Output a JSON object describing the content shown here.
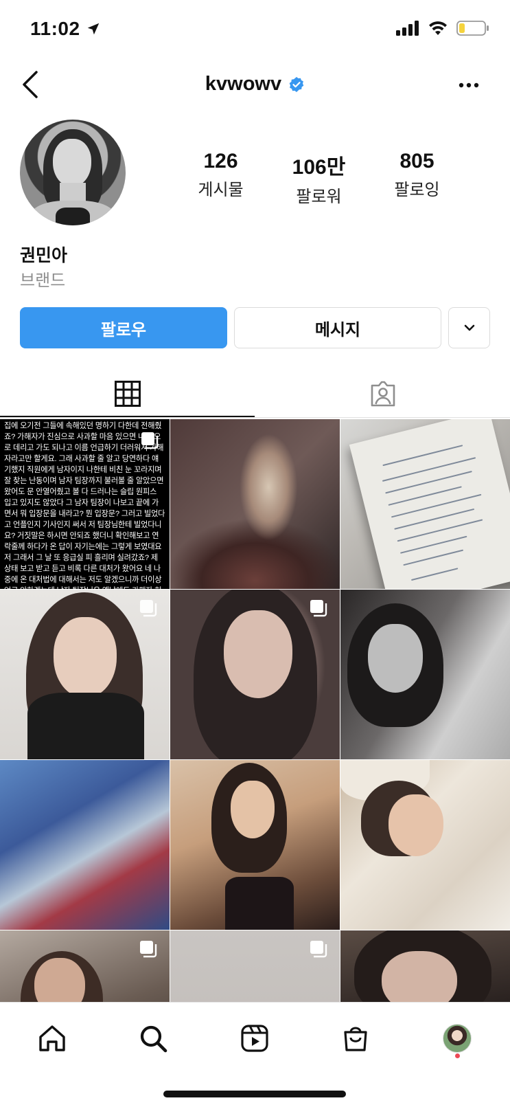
{
  "status_bar": {
    "time": "11:02",
    "icons": [
      "location-arrow-icon",
      "signal-bars-icon",
      "wifi-icon",
      "battery-low-icon"
    ]
  },
  "header": {
    "username": "kvwowv",
    "verified_icon": "verified-badge-icon",
    "back_icon": "chevron-left-icon",
    "more_icon": "more-horizontal-icon"
  },
  "profile": {
    "name": "권민아",
    "category": "브랜드",
    "stats": [
      {
        "value": "126",
        "label": "게시물"
      },
      {
        "value": "106만",
        "label": "팔로워"
      },
      {
        "value": "805",
        "label": "팔로잉"
      }
    ]
  },
  "actions": {
    "follow_label": "팔로우",
    "message_label": "메시지",
    "more_icon": "chevron-down-icon",
    "follow_color": "#3897f0"
  },
  "tabs": [
    {
      "name": "grid",
      "icon": "grid-icon",
      "active": true
    },
    {
      "name": "tagged",
      "icon": "tagged-person-icon",
      "active": false
    }
  ],
  "posts": {
    "text_post": "집에 오기전 그들에 속해있던 명하기 다한데 전해줬죠? 가해자가 진심으로 사과할 마음 있으면 내 집으로 데리고 가도 되나고 이름 언급하기 더러워서 가해자라고만 할게요. 그래 사과할 줄 알고 당연하다 얘기했지 직원에게 남자이지 나한테 비친 눈 꼬라지며 잘 찾는 난동이며 남자 팀장까지 불러볼 줄 알았으면 왔어도 문 안열어줬고 볼 다 드러나는 슬립 원피스 입고 있지도 않았다 그 남자 팀장이 나보고 끝에 가면서 뭐 입장문을 내라고? 뭔 입장문? 그러고 빌었다고 언플인지 기사인지 써서 저 팀장님한테 빌었다니요? 거짓말은 하시면 안되죠 했더니 확인해보고 연락줄께 하다가 온 답이 자기는에는 그렇게 보였대요 저 그래서 그 날 또 응급실 피 흘리며 실려갔죠? 제 상태 보고 받고 듣고 비록 다른 대처가 왔어요 네 나중에 온 대처법에 대해서는 저도 알겠으니까 더이상 언급 안하겠는데 남자 팀장님은 옛날에도 가해자 허락만 받고 숙소에 오시는 바람에 온줄도 모르고 다 벗은 제 꼴도 보셨잖아요 멤버가 3명이 같이 사는데 친하다는 이유로 가해자 허락만 맡고와? 그래도 화 안냈어요 민망하고 웃고 넘겼어요 알죠? 분위기 이상하게 만들면 또 가해자가 가만히 있었겠어요?ㅋㅋ아닌건 아니라고 말 하고 싶었으면 썼어야 자꾸만 더 풀고 싶은건 생겼는데",
    "multi_icon": "carousel-icon",
    "count_visible": 12
  },
  "bottom_nav": [
    {
      "name": "home",
      "icon": "home-icon"
    },
    {
      "name": "search",
      "icon": "search-icon"
    },
    {
      "name": "reels",
      "icon": "reels-icon"
    },
    {
      "name": "shop",
      "icon": "shopping-bag-icon"
    },
    {
      "name": "profile",
      "icon": "profile-avatar-icon"
    }
  ]
}
